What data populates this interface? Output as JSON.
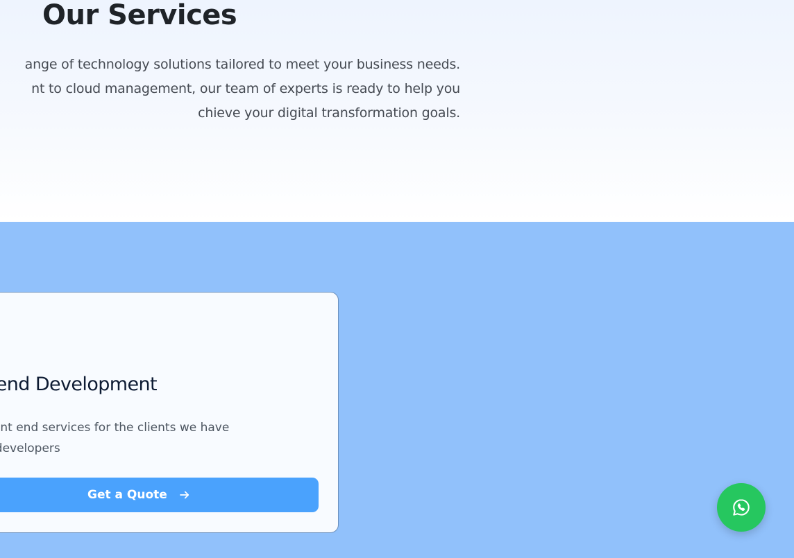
{
  "hero": {
    "title": "Our Services",
    "description_lines": [
      "ange of technology solutions tailored to meet your business needs.",
      "nt to cloud management, our team of experts is ready to help you",
      "chieve your digital transformation goals."
    ]
  },
  "service_card": {
    "title": "end Development",
    "description_lines": [
      "ide front end services for the clients we have",
      "nced developers"
    ],
    "button_label": "Get a Quote",
    "button_icon": "arrow-right-icon"
  },
  "floating_action": {
    "icon": "whatsapp-icon"
  },
  "colors": {
    "band_background": "#91c1fb",
    "button_primary": "#4aa2fd",
    "whatsapp_green": "#26c75f"
  }
}
